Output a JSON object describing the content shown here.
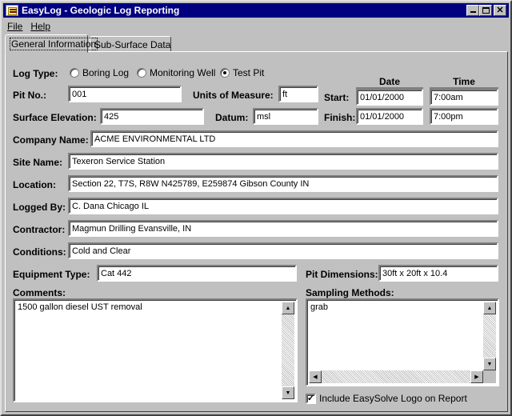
{
  "window": {
    "title": "EasyLog - Geologic Log Reporting",
    "minimize_glyph": "",
    "close_glyph": "✕"
  },
  "menu": [
    "File",
    "Help"
  ],
  "tabs": [
    "General Information",
    "Sub-Surface Data"
  ],
  "form": {
    "log_type": {
      "label": "Log Type:",
      "options": [
        "Boring Log",
        "Monitoring Well",
        "Test Pit"
      ],
      "selected": "Test Pit"
    },
    "pit_no": {
      "label": "Pit No.:",
      "value": "001"
    },
    "units": {
      "label": "Units of Measure:",
      "value": "ft"
    },
    "surface_elevation": {
      "label": "Surface Elevation:",
      "value": "425"
    },
    "datum": {
      "label": "Datum:",
      "value": "msl"
    },
    "date_header": "Date",
    "time_header": "Time",
    "start": {
      "label": "Start:",
      "date": "01/01/2000",
      "time": "7:00am"
    },
    "finish": {
      "label": "Finish:",
      "date": "01/01/2000",
      "time": "7:00pm"
    },
    "company_name": {
      "label": "Company Name:",
      "value": "ACME ENVIRONMENTAL LTD"
    },
    "site_name": {
      "label": "Site Name:",
      "value": "Texeron Service Station"
    },
    "location": {
      "label": "Location:",
      "value": "Section 22, T7S, R8W   N425789, E259874  Gibson County IN"
    },
    "logged_by": {
      "label": "Logged By:",
      "value": "C. Dana  Chicago IL"
    },
    "contractor": {
      "label": "Contractor:",
      "value": "Magmun Drilling Evansville, IN"
    },
    "conditions": {
      "label": "Conditions:",
      "value": "Cold and Clear"
    },
    "equipment_type": {
      "label": "Equipment Type:",
      "value": "Cat 442"
    },
    "pit_dimensions": {
      "label": "Pit Dimensions:",
      "value": "30ft x 20ft x 10.4"
    },
    "comments": {
      "label": "Comments:",
      "value": "1500 gallon diesel UST removal"
    },
    "sampling_methods": {
      "label": "Sampling Methods:",
      "value": "grab"
    },
    "include_logo": {
      "label": "Include EasySolve Logo on Report",
      "checked": true
    }
  }
}
